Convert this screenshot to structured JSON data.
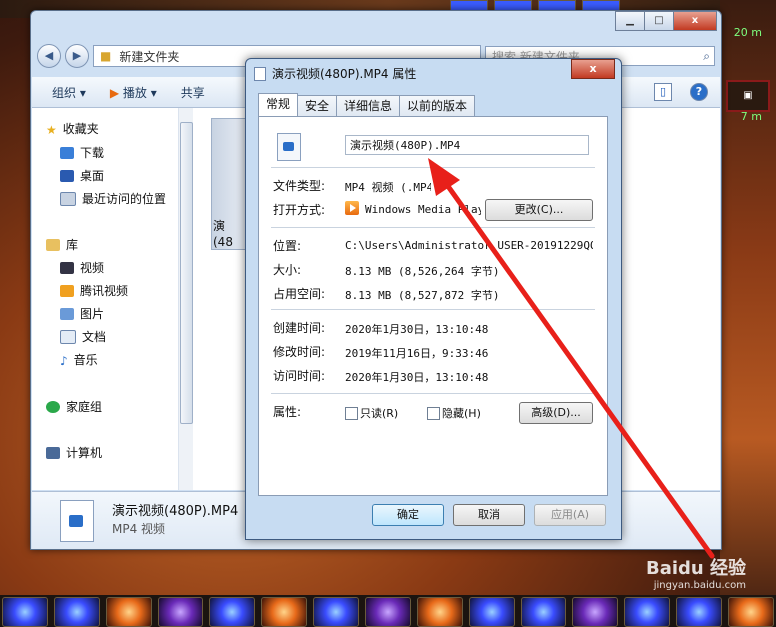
{
  "game": {
    "side_top_label": "20 m",
    "side_mid_label": "7 m"
  },
  "explorer": {
    "address": "新建文件夹",
    "search_placeholder": "搜索 新建文件夹",
    "toolbar": {
      "organize": "组织",
      "play": "播放",
      "share": "共享"
    },
    "sidebar": {
      "favorites": "收藏夹",
      "downloads": "下载",
      "desktop": "桌面",
      "recent": "最近访问的位置",
      "libraries": "库",
      "videos": "视频",
      "tencent_video": "腾讯视频",
      "pictures": "图片",
      "documents": "文档",
      "music": "音乐",
      "homegroup": "家庭组",
      "computer": "计算机"
    },
    "file_thumb_label_1": "演",
    "file_thumb_label_2": "(48",
    "details": {
      "name": "演示视频(480P).MP4",
      "type": "MP4 视频"
    }
  },
  "dialog": {
    "title": "演示视频(480P).MP4 属性",
    "close": "x",
    "tabs": [
      "常规",
      "安全",
      "详细信息",
      "以前的版本"
    ],
    "filename": "演示视频(480P).MP4",
    "file_type_label": "文件类型:",
    "file_type_value": "MP4 视频 (.MP4)",
    "open_with_label": "打开方式:",
    "open_with_value": "Windows Media Player",
    "change_button": "更改(C)...",
    "location_label": "位置:",
    "location_value": "C:\\Users\\Administrator.USER-20191229QO\\De",
    "size_label": "大小:",
    "size_value": "8.13 MB (8,526,264 字节)",
    "size_on_disk_label": "占用空间:",
    "size_on_disk_value": "8.13 MB (8,527,872 字节)",
    "created_label": "创建时间:",
    "created_value": "2020年1月30日，13:10:48",
    "modified_label": "修改时间:",
    "modified_value": "2019年11月16日，9:33:46",
    "accessed_label": "访问时间:",
    "accessed_value": "2020年1月30日，13:10:48",
    "attributes_label": "属性:",
    "readonly_label": "只读(R)",
    "hidden_label": "隐藏(H)",
    "advanced_button": "高级(D)...",
    "ok_button": "确定",
    "cancel_button": "取消",
    "apply_button": "应用(A)"
  },
  "watermark": {
    "brand": "Baidu 经验",
    "url": "jingyan.baidu.com"
  },
  "colors": {
    "arrow": "#e8201a",
    "window_frame": "#c7dcf2",
    "accent": "#2a6ec8"
  }
}
